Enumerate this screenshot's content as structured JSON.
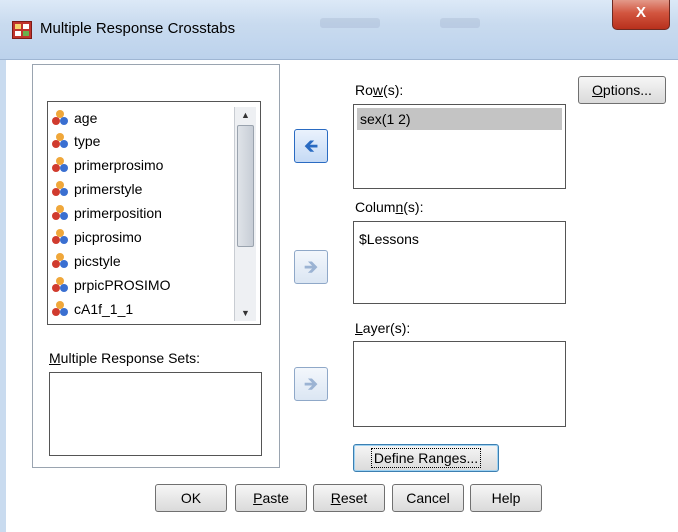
{
  "window": {
    "title": "Multiple Response Crosstabs",
    "close_glyph": "X"
  },
  "variables": {
    "items": [
      "age",
      "type",
      "primerprosimo",
      "primerstyle",
      "primerposition",
      "picprosimo",
      "picstyle",
      "prpicPROSIMO",
      "cA1f_1_1"
    ]
  },
  "mr_sets": {
    "label_prefix": "M",
    "label_rest": "ultiple Response Sets:"
  },
  "rows": {
    "label_pre": "Ro",
    "label_u": "w",
    "label_post": "(s):",
    "items": [
      "sex(1 2)"
    ]
  },
  "columns": {
    "label_pre": "Colum",
    "label_u": "n",
    "label_post": "(s):",
    "items": [
      "$Lessons"
    ]
  },
  "layers": {
    "label_pre": "",
    "label_u": "L",
    "label_post": "ayer(s):",
    "items": []
  },
  "buttons": {
    "options_u": "O",
    "options_rest": "ptions...",
    "define_ranges": "Define Ranges...",
    "ok": "OK",
    "paste_u": "P",
    "paste_rest": "aste",
    "reset_u": "R",
    "reset_rest": "eset",
    "cancel": "Cancel",
    "help": "Help"
  },
  "colors": {
    "accent": "#2a6bc2",
    "selection": "#c4c4c4",
    "close": "#c9402a"
  }
}
